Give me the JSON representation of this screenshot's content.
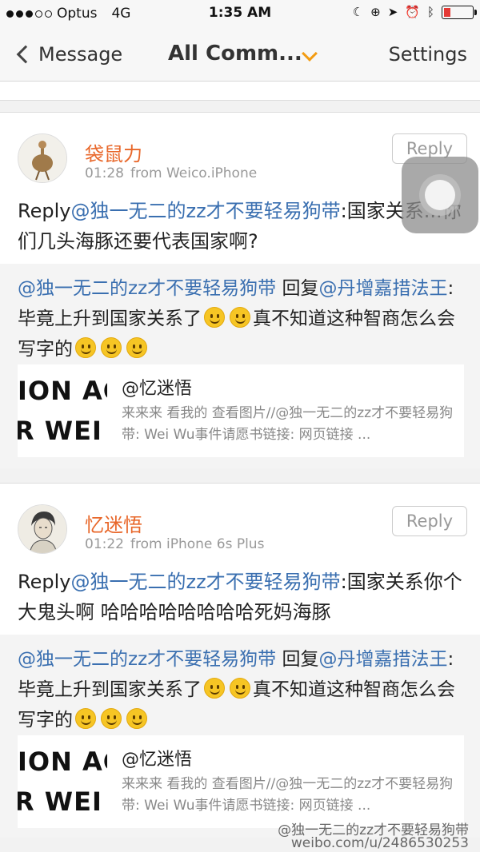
{
  "status_bar": {
    "carrier": "Optus",
    "network": "4G",
    "time": "1:35 AM"
  },
  "nav": {
    "back_label": "Message",
    "title": "All Comm...",
    "settings_label": "Settings"
  },
  "comments": [
    {
      "username": "袋鼠力",
      "time": "01:28",
      "source": "from Weico.iPhone",
      "reply_button": "Reply",
      "text_prefix": "Reply",
      "text_mention": "@独一无二的zz才不要轻易狗带",
      "text_body": ":国家关系...你们几头海豚还要代表国家啊?",
      "quote": {
        "mention1": "@独一无二的zz才不要轻易狗带",
        "reply_word": " 回复",
        "mention2": "@丹增嘉措法王",
        "body1": ": 毕竟上升到国家关系了",
        "body2": "真不知道这种智商怎么会写字的"
      },
      "link": {
        "thumb_line1": "ION AG",
        "thumb_line2": "R WEI W",
        "title": "@忆迷悟",
        "desc": "来来来 看我的 查看图片//@独一无二的zz才不要轻易狗带: Wei Wu事件请愿书链接: 网页链接 ..."
      }
    },
    {
      "username": "忆迷悟",
      "time": "01:22",
      "source": "from iPhone 6s Plus",
      "reply_button": "Reply",
      "text_prefix": "Reply",
      "text_mention": "@独一无二的zz才不要轻易狗带",
      "text_body": ":国家关系你个大鬼头啊 哈哈哈哈哈哈哈哈死妈海豚",
      "quote": {
        "mention1": "@独一无二的zz才不要轻易狗带",
        "reply_word": " 回复",
        "mention2": "@丹增嘉措法王",
        "body1": ": 毕竟上升到国家关系了",
        "body2": "真不知道这种智商怎么会写字的"
      },
      "link": {
        "thumb_line1": "ION AG",
        "thumb_line2": "R WEI W",
        "title": "@忆迷悟",
        "desc": "来来来 看我的 查看图片//@独一无二的zz才不要轻易狗带: Wei Wu事件请愿书链接: 网页链接 ..."
      }
    }
  ],
  "watermark": {
    "line1": "@独一无二的zz才不要轻易狗带",
    "line2": "weibo.com/u/2486530253"
  },
  "colors": {
    "username": "#e8672a",
    "mention": "#3a6fb0",
    "accent": "#f39c12"
  }
}
